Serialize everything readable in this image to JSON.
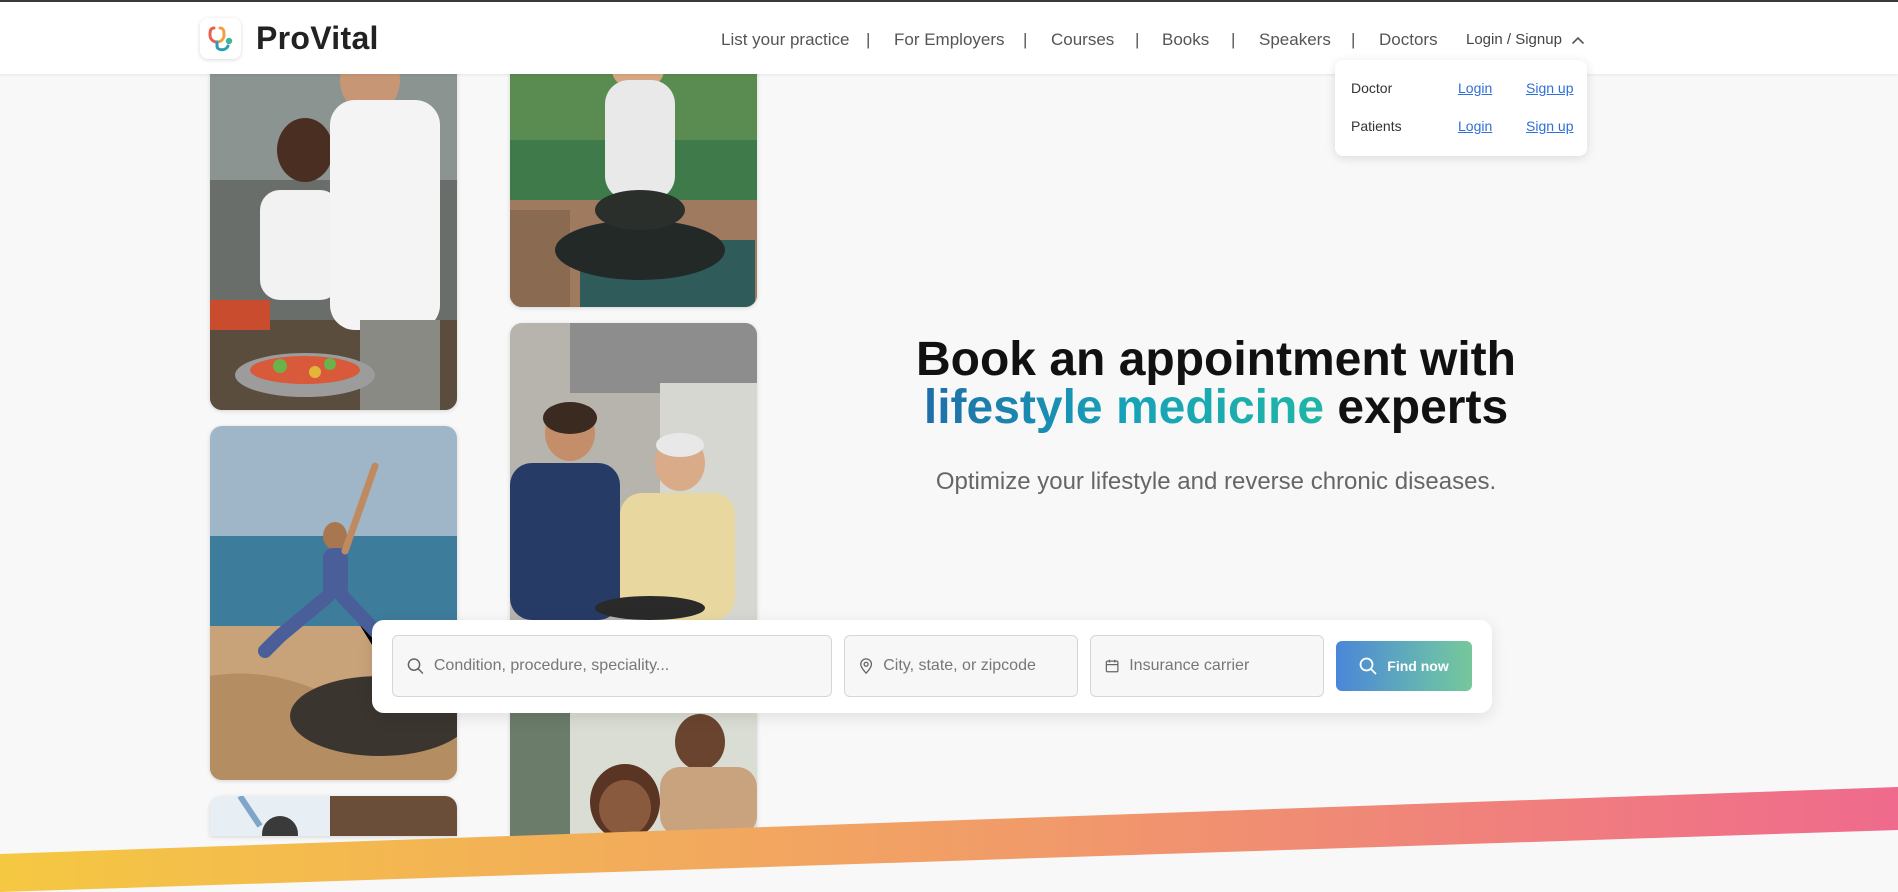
{
  "header": {
    "brand": "ProVital",
    "nav": [
      {
        "label": "List your practice"
      },
      {
        "label": "For Employers"
      },
      {
        "label": "Courses"
      },
      {
        "label": "Books"
      },
      {
        "label": "Speakers"
      },
      {
        "label": "Doctors"
      }
    ],
    "separator": "|",
    "login_toggle": "Login / Signup"
  },
  "login_dropdown": {
    "rows": [
      {
        "label": "Doctor",
        "login": "Login",
        "signup": "Sign up"
      },
      {
        "label": "Patients",
        "login": "Login",
        "signup": "Sign up"
      }
    ]
  },
  "hero": {
    "title_line1": "Book an appointment with",
    "title_accent": "lifestyle medicine",
    "title_end": " experts",
    "subtitle": "Optimize your lifestyle and reverse chronic diseases."
  },
  "search": {
    "condition_placeholder": "Condition, procedure, speciality...",
    "location_placeholder": "City, state, or zipcode",
    "insurance_placeholder": "Insurance carrier",
    "button_label": "Find now"
  },
  "photos": [
    {
      "name": "couple-cooking-photo"
    },
    {
      "name": "seated-yoga-photo"
    },
    {
      "name": "beach-yoga-photo"
    },
    {
      "name": "kitchen-father-son-photo"
    },
    {
      "name": "partial-photo-left-bottom"
    },
    {
      "name": "smiling-couple-photo"
    }
  ],
  "colors": {
    "accent_blue": "#1f6ea8",
    "accent_teal": "#20b5a6",
    "link": "#2f6fd8",
    "stripe_start": "#f5c842",
    "stripe_end": "#ef6a8c"
  },
  "icons": {
    "logo": "stethoscope-icon",
    "toggle": "chevron-up-icon",
    "search": "search-icon",
    "location": "map-pin-icon",
    "insurance": "calendar-icon"
  }
}
